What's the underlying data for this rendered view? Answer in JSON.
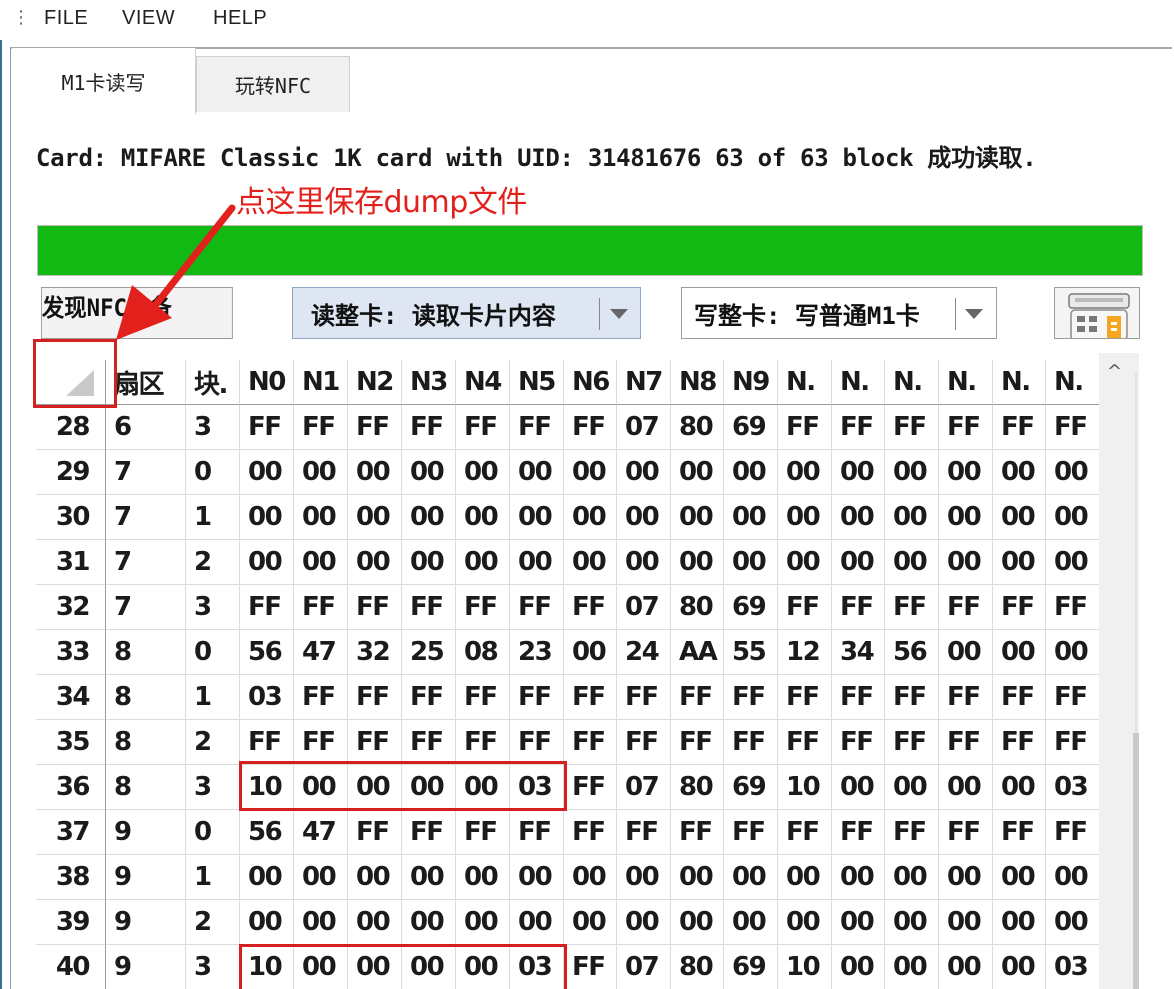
{
  "menubar": {
    "grip": "⋮",
    "items": [
      "FILE",
      "VIEW",
      "HELP"
    ]
  },
  "tabs": [
    {
      "label": "M1卡读写",
      "selected": true
    },
    {
      "label": "玩转NFC",
      "selected": false
    }
  ],
  "card_info": "Card: MIFARE Classic 1K card with UID: 31481676 63 of 63 block 成功读取.",
  "progress": {
    "percent": 100,
    "color": "#13b913"
  },
  "toolbar": {
    "discover_button": "发现NFC设备",
    "read_combo": {
      "value": "读整卡: 读取卡片内容"
    },
    "write_combo": {
      "value": "写整卡: 写普通M1卡"
    }
  },
  "annotation": {
    "text": "点这里保存dump文件",
    "color": "#e3211c"
  },
  "table": {
    "columns": [
      "扇区",
      "块.",
      "N0",
      "N1",
      "N2",
      "N3",
      "N4",
      "N5",
      "N6",
      "N7",
      "N8",
      "N9",
      "N.",
      "N.",
      "N.",
      "N.",
      "N.",
      "N."
    ],
    "rows": [
      [
        "28",
        "6",
        "3",
        "FF",
        "FF",
        "FF",
        "FF",
        "FF",
        "FF",
        "FF",
        "07",
        "80",
        "69",
        "FF",
        "FF",
        "FF",
        "FF",
        "FF",
        "FF"
      ],
      [
        "29",
        "7",
        "0",
        "00",
        "00",
        "00",
        "00",
        "00",
        "00",
        "00",
        "00",
        "00",
        "00",
        "00",
        "00",
        "00",
        "00",
        "00",
        "00"
      ],
      [
        "30",
        "7",
        "1",
        "00",
        "00",
        "00",
        "00",
        "00",
        "00",
        "00",
        "00",
        "00",
        "00",
        "00",
        "00",
        "00",
        "00",
        "00",
        "00"
      ],
      [
        "31",
        "7",
        "2",
        "00",
        "00",
        "00",
        "00",
        "00",
        "00",
        "00",
        "00",
        "00",
        "00",
        "00",
        "00",
        "00",
        "00",
        "00",
        "00"
      ],
      [
        "32",
        "7",
        "3",
        "FF",
        "FF",
        "FF",
        "FF",
        "FF",
        "FF",
        "FF",
        "07",
        "80",
        "69",
        "FF",
        "FF",
        "FF",
        "FF",
        "FF",
        "FF"
      ],
      [
        "33",
        "8",
        "0",
        "56",
        "47",
        "32",
        "25",
        "08",
        "23",
        "00",
        "24",
        "AA",
        "55",
        "12",
        "34",
        "56",
        "00",
        "00",
        "00"
      ],
      [
        "34",
        "8",
        "1",
        "03",
        "FF",
        "FF",
        "FF",
        "FF",
        "FF",
        "FF",
        "FF",
        "FF",
        "FF",
        "FF",
        "FF",
        "FF",
        "FF",
        "FF",
        "FF"
      ],
      [
        "35",
        "8",
        "2",
        "FF",
        "FF",
        "FF",
        "FF",
        "FF",
        "FF",
        "FF",
        "FF",
        "FF",
        "FF",
        "FF",
        "FF",
        "FF",
        "FF",
        "FF",
        "FF"
      ],
      [
        "36",
        "8",
        "3",
        "10",
        "00",
        "00",
        "00",
        "00",
        "03",
        "FF",
        "07",
        "80",
        "69",
        "10",
        "00",
        "00",
        "00",
        "00",
        "03"
      ],
      [
        "37",
        "9",
        "0",
        "56",
        "47",
        "FF",
        "FF",
        "FF",
        "FF",
        "FF",
        "FF",
        "FF",
        "FF",
        "FF",
        "FF",
        "FF",
        "FF",
        "FF",
        "FF"
      ],
      [
        "38",
        "9",
        "1",
        "00",
        "00",
        "00",
        "00",
        "00",
        "00",
        "00",
        "00",
        "00",
        "00",
        "00",
        "00",
        "00",
        "00",
        "00",
        "00"
      ],
      [
        "39",
        "9",
        "2",
        "00",
        "00",
        "00",
        "00",
        "00",
        "00",
        "00",
        "00",
        "00",
        "00",
        "00",
        "00",
        "00",
        "00",
        "00",
        "00"
      ],
      [
        "40",
        "9",
        "3",
        "10",
        "00",
        "00",
        "00",
        "00",
        "03",
        "FF",
        "07",
        "80",
        "69",
        "10",
        "00",
        "00",
        "00",
        "00",
        "03"
      ]
    ]
  }
}
